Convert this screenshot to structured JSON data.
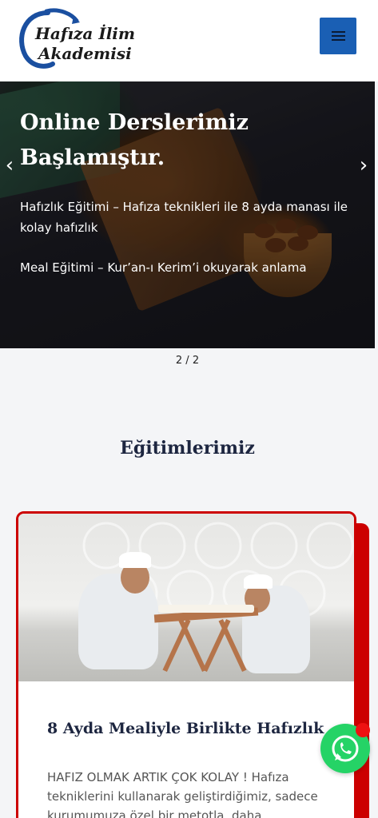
{
  "header": {
    "logo_line1": "Hafıza İlim",
    "logo_line2": "Akademisi"
  },
  "slider": {
    "title": "Online Derslerimiz Başlamıştır.",
    "line1": "Hafızlık Eğitimi – Hafıza teknikleri ile 8 ayda manası ile kolay hafızlık",
    "line2": "Meal Eğitimi – Kur’an-ı Kerim’i okuyarak anlama",
    "counter": "2 / 2",
    "prev_icon": "‹",
    "next_icon": "›"
  },
  "section": {
    "title": "Eğitimlerimiz"
  },
  "card": {
    "title": "8 Ayda Mealiyle Birlikte Hafızlık",
    "text": "HAFIZ OLMAK ARTIK ÇOK KOLAY ! Hafıza tekniklerini kullanarak geliştirdiğimiz, sadece kurumumuza özel bir metotla, daha"
  },
  "colors": {
    "menu_button": "#1a5fb4",
    "card_border": "#cc0000",
    "whatsapp": "#25d366",
    "title_navy": "#1d2640"
  },
  "icons": {
    "menu": "hamburger-icon",
    "whatsapp": "whatsapp-icon"
  }
}
